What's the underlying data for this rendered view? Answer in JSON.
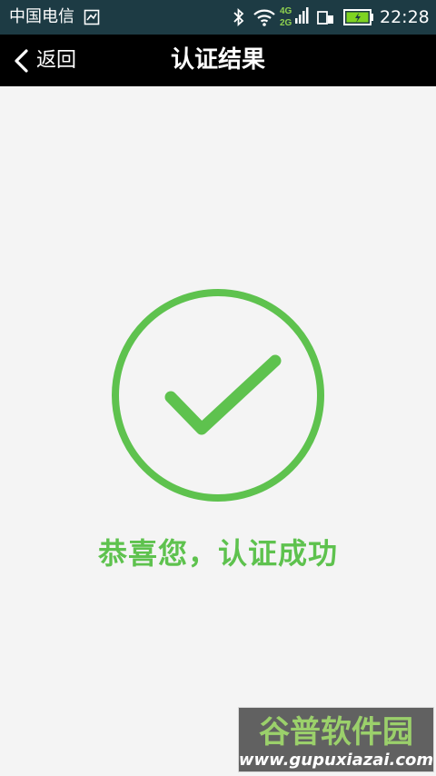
{
  "status_bar": {
    "carrier": "中国电信",
    "network_types": [
      "4G",
      "2G"
    ],
    "time": "22:28",
    "colors": {
      "background": "#1d3b44",
      "battery_fill": "#7ed321",
      "network_label": "#8fd14f"
    },
    "icons": [
      "sim-card-icon",
      "bluetooth-icon",
      "wifi-icon",
      "signal-icon",
      "sim-slot-icon",
      "battery-charging-icon"
    ]
  },
  "header": {
    "back_label": "返回",
    "title": "认证结果",
    "icons": [
      "chevron-left-icon"
    ]
  },
  "main": {
    "icon": "check-circle-icon",
    "message": "恭喜您，认证成功",
    "accent_color": "#5ec24e"
  },
  "watermark": {
    "brand": "谷普软件园",
    "url": "www.gupuxiazai.com"
  }
}
